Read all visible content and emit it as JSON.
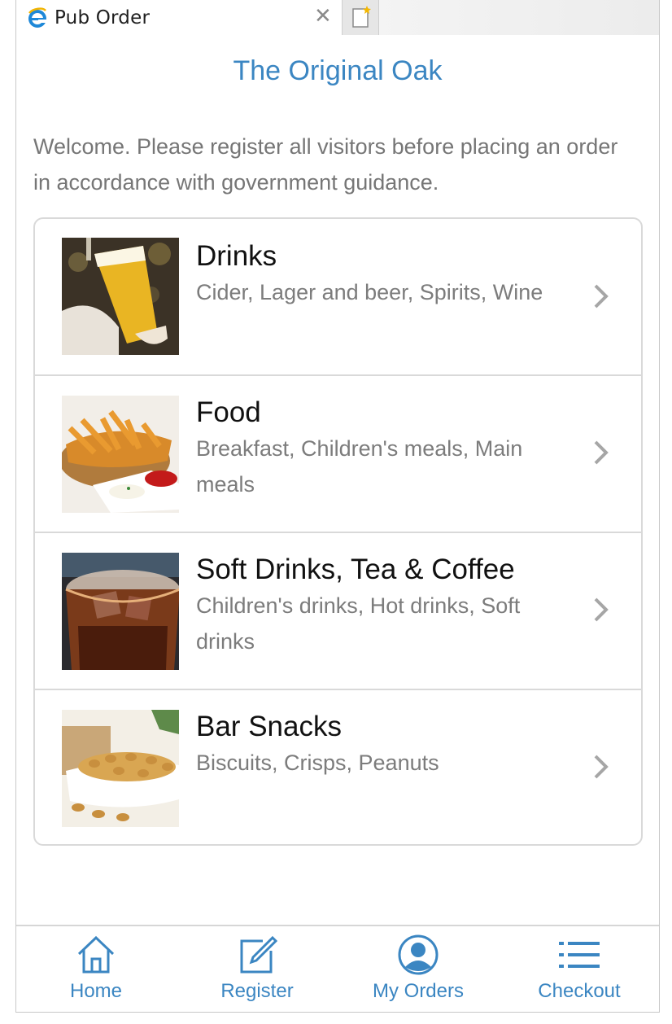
{
  "browser": {
    "tab_title": "Pub Order",
    "close_glyph": "✕",
    "icons": {
      "tab": "ie-icon",
      "close": "close-icon",
      "new_tab": "new-tab-icon"
    }
  },
  "header": {
    "title": "The Original Oak"
  },
  "welcome": "Welcome. Please register all visitors before placing an order in accordance with government guidance.",
  "categories": [
    {
      "title": "Drinks",
      "subtitle": "Cider, Lager and beer, Spirits, Wine",
      "image": "beer-glass-image"
    },
    {
      "title": "Food",
      "subtitle": "Breakfast, Children's meals, Main meals",
      "image": "chips-basket-image"
    },
    {
      "title": "Soft Drinks, Tea & Coffee",
      "subtitle": "Children's drinks, Hot drinks, Soft drinks",
      "image": "cola-glass-image"
    },
    {
      "title": "Bar Snacks",
      "subtitle": "Biscuits, Crisps, Peanuts",
      "image": "peanuts-bowl-image"
    }
  ],
  "bottom_nav": [
    {
      "label": "Home",
      "icon": "home-icon"
    },
    {
      "label": "Register",
      "icon": "edit-icon"
    },
    {
      "label": "My Orders",
      "icon": "user-icon"
    },
    {
      "label": "Checkout",
      "icon": "list-icon"
    }
  ],
  "colors": {
    "accent": "#3b86c2",
    "muted_text": "#767676",
    "border": "#d9d9d9"
  }
}
